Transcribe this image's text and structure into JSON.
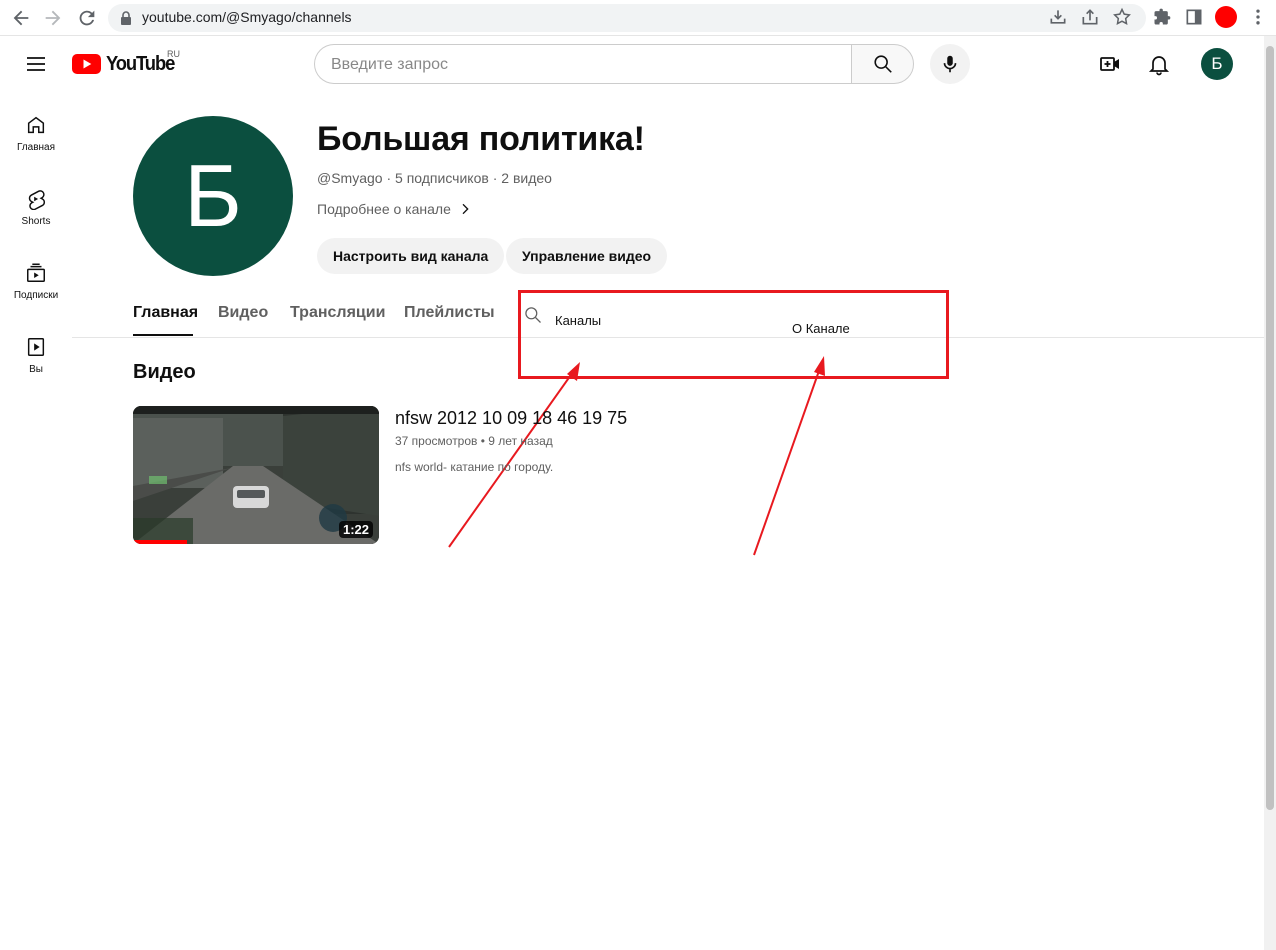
{
  "browser": {
    "url": "youtube.com/@Smyago/channels"
  },
  "masthead": {
    "logo_text": "YouTube",
    "logo_region": "RU",
    "search_placeholder": "Введите запрос",
    "avatar_letter": "Б"
  },
  "sidebar": {
    "items": [
      {
        "label": "Главная",
        "icon": "home-icon"
      },
      {
        "label": "Shorts",
        "icon": "shorts-icon"
      },
      {
        "label": "Подписки",
        "icon": "subscriptions-icon"
      },
      {
        "label": "Вы",
        "icon": "library-icon"
      }
    ]
  },
  "channel": {
    "avatar_letter": "Б",
    "title": "Большая политика!",
    "handle": "@Smyago",
    "subscribers": "5 подписчиков",
    "videos_count": "2 видео",
    "about_link": "Подробнее о канале",
    "customize_button": "Настроить вид канала",
    "manage_button": "Управление видео"
  },
  "tabs": [
    {
      "label": "Главная",
      "active": true
    },
    {
      "label": "Видео",
      "active": false
    },
    {
      "label": "Трансляции",
      "active": false
    },
    {
      "label": "Плейлисты",
      "active": false
    }
  ],
  "annotation": {
    "color": "#e8191f",
    "label_channels": "Каналы",
    "label_about": "О Канале"
  },
  "section": {
    "title": "Видео"
  },
  "video": {
    "title": "nfsw 2012 10 09 18 46 19 75",
    "views": "37 просмотров",
    "age": "9 лет назад",
    "description": "nfs world- катание по городу.",
    "duration": "1:22",
    "watched_fraction": 0.22
  },
  "colors": {
    "brand_red": "#ff0000",
    "avatar_green": "#0b4f3f"
  }
}
